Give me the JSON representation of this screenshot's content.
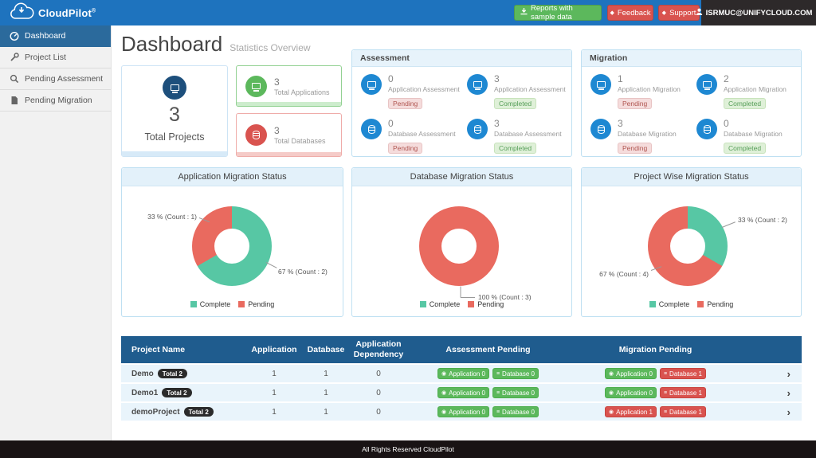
{
  "navbar": {
    "brand": "CloudPilot",
    "brand_mark": "®",
    "reports_button": "Reports with sample data",
    "feedback_button": "Feedback",
    "support_button": "Support",
    "user_email": "ISRMUC@UNIFYCLOUD.COM"
  },
  "sidebar": {
    "items": [
      {
        "label": "Dashboard",
        "active": true
      },
      {
        "label": "Project List",
        "active": false
      },
      {
        "label": "Pending Assessment",
        "active": false
      },
      {
        "label": "Pending Migration",
        "active": false
      }
    ]
  },
  "page_header": {
    "title": "Dashboard",
    "subtitle": "Statistics Overview"
  },
  "summary": {
    "projects": {
      "value": "3",
      "label": "Total Projects"
    },
    "applications": {
      "value": "3",
      "label": "Total Applications"
    },
    "databases": {
      "value": "3",
      "label": "Total Databases"
    }
  },
  "assessment": {
    "title": "Assessment",
    "items": [
      {
        "value": "0",
        "label": "Application Assessment",
        "status": "Pending"
      },
      {
        "value": "3",
        "label": "Application Assessment",
        "status": "Completed"
      },
      {
        "value": "0",
        "label": "Database Assessment",
        "status": "Pending"
      },
      {
        "value": "3",
        "label": "Database Assessment",
        "status": "Completed"
      }
    ]
  },
  "migration": {
    "title": "Migration",
    "items": [
      {
        "value": "1",
        "label": "Application Migration",
        "status": "Pending"
      },
      {
        "value": "2",
        "label": "Application Migration",
        "status": "Completed"
      },
      {
        "value": "3",
        "label": "Database Migration",
        "status": "Pending"
      },
      {
        "value": "0",
        "label": "Database Migration",
        "status": "Completed"
      }
    ]
  },
  "chart_data": [
    {
      "type": "pie",
      "donut": true,
      "title": "Application Migration Status",
      "labels": [
        "Complete",
        "Pending"
      ],
      "values": [
        2,
        1
      ],
      "percentages": [
        67,
        33
      ],
      "annotations": [
        "33 % (Count : 1)",
        "67 % (Count : 2)"
      ],
      "colors": {
        "complete": "#57c7a4",
        "pending": "#e96a5f"
      },
      "legend_position": "bottom"
    },
    {
      "type": "pie",
      "donut": true,
      "title": "Database Migration Status",
      "labels": [
        "Complete",
        "Pending"
      ],
      "values": [
        0,
        3
      ],
      "percentages": [
        0,
        100
      ],
      "annotations": [
        "100 % (Count : 3)"
      ],
      "colors": {
        "complete": "#57c7a4",
        "pending": "#e96a5f"
      },
      "legend_position": "bottom"
    },
    {
      "type": "pie",
      "donut": true,
      "title": "Project Wise Migration Status",
      "labels": [
        "Complete",
        "Pending"
      ],
      "values": [
        2,
        4
      ],
      "percentages": [
        33,
        67
      ],
      "annotations": [
        "33 % (Count : 2)",
        "67 % (Count : 4)"
      ],
      "colors": {
        "complete": "#57c7a4",
        "pending": "#e96a5f"
      },
      "legend_position": "bottom"
    }
  ],
  "table": {
    "columns": [
      "Project Name",
      "Application",
      "Database",
      "Application Dependency",
      "Assessment Pending",
      "Migration Pending"
    ],
    "rows": [
      {
        "name": "Demo",
        "total_badge": "Total 2",
        "application": "1",
        "database": "1",
        "dependency": "0",
        "assessment_badges": [
          {
            "label": "Application 0",
            "color": "green"
          },
          {
            "label": "Database 0",
            "color": "green"
          }
        ],
        "migration_badges": [
          {
            "label": "Application 0",
            "color": "green"
          },
          {
            "label": "Database 1",
            "color": "red"
          }
        ]
      },
      {
        "name": "Demo1",
        "total_badge": "Total 2",
        "application": "1",
        "database": "1",
        "dependency": "0",
        "assessment_badges": [
          {
            "label": "Application 0",
            "color": "green"
          },
          {
            "label": "Database 0",
            "color": "green"
          }
        ],
        "migration_badges": [
          {
            "label": "Application 0",
            "color": "green"
          },
          {
            "label": "Database 1",
            "color": "red"
          }
        ]
      },
      {
        "name": "demoProject",
        "total_badge": "Total 2",
        "application": "1",
        "database": "1",
        "dependency": "0",
        "assessment_badges": [
          {
            "label": "Application 0",
            "color": "green"
          },
          {
            "label": "Database 0",
            "color": "green"
          }
        ],
        "migration_badges": [
          {
            "label": "Application 1",
            "color": "red"
          },
          {
            "label": "Database 1",
            "color": "red"
          }
        ]
      }
    ]
  },
  "footer": {
    "text": "All Rights Reserved CloudPilot"
  },
  "colors": {
    "navbar": "#1e73be",
    "sidebar_active": "#2b6a9c",
    "green": "#5cb85c",
    "red": "#d9534f",
    "accent_blue": "#1e88d2",
    "table_header": "#1f5c8e",
    "teal": "#57c7a4",
    "salmon": "#e96a5f"
  }
}
